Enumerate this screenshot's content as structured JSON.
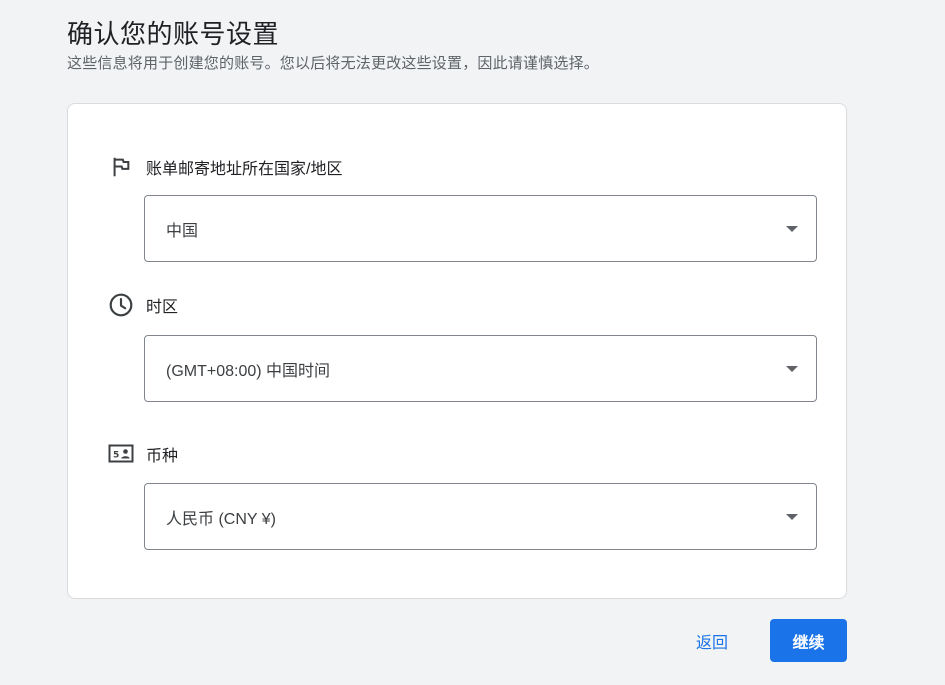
{
  "header": {
    "title": "确认您的账号设置",
    "subtitle": "这些信息将用于创建您的账号。您以后将无法更改这些设置，因此请谨慎选择。"
  },
  "settings": {
    "country": {
      "icon": "flag-icon",
      "label": "账单邮寄地址所在国家/地区",
      "value": "中国"
    },
    "timezone": {
      "icon": "clock-icon",
      "label": "时区",
      "value": "(GMT+08:00) 中国时间"
    },
    "currency": {
      "icon": "currency-icon",
      "label": "币种",
      "value": "人民币 (CNY ¥)"
    }
  },
  "actions": {
    "back_label": "返回",
    "continue_label": "继续"
  },
  "colors": {
    "accent": "#1a73e8",
    "background": "#f1f3f4",
    "border": "#dadce0",
    "select_border": "#80868b"
  }
}
